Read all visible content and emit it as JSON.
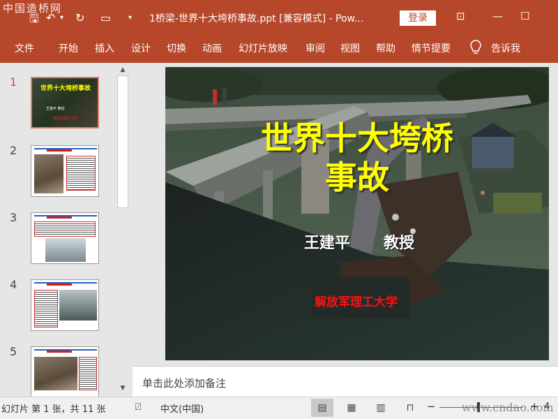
{
  "watermark_top": "中国造桥网",
  "watermark_bottom": "www.cndao.com",
  "window": {
    "title": "1桥梁-世界十大垮桥事故.ppt [兼容模式] - Pow...",
    "login_label": "登录"
  },
  "ribbon": {
    "tabs": [
      "文件",
      "开始",
      "插入",
      "设计",
      "切换",
      "动画",
      "幻灯片放映",
      "审阅",
      "视图",
      "帮助",
      "情节提要"
    ],
    "tell_me": "告诉我"
  },
  "thumbnails": {
    "numbers": [
      "1",
      "2",
      "3",
      "4",
      "5"
    ],
    "slide1_title": "世界十大垮桥事故",
    "slide1_name": "王建平 教授",
    "slide1_univ": "解放军理工大学"
  },
  "slide": {
    "title_line1": "世界十大垮桥",
    "title_line2": "事故",
    "author": "王建平",
    "role": "教授",
    "institution": "解放军理工大学"
  },
  "notes_placeholder": "单击此处添加备注",
  "status": {
    "slide_info": "幻灯片 第 1 张，共 11 张",
    "language": "中文(中国)",
    "zoom_minus": "−",
    "zoom_plus": "+",
    "zoom_level": "4"
  },
  "colors": {
    "accent": "#b7472a",
    "slide_title": "#ffff00",
    "institution": "#ff1010"
  }
}
